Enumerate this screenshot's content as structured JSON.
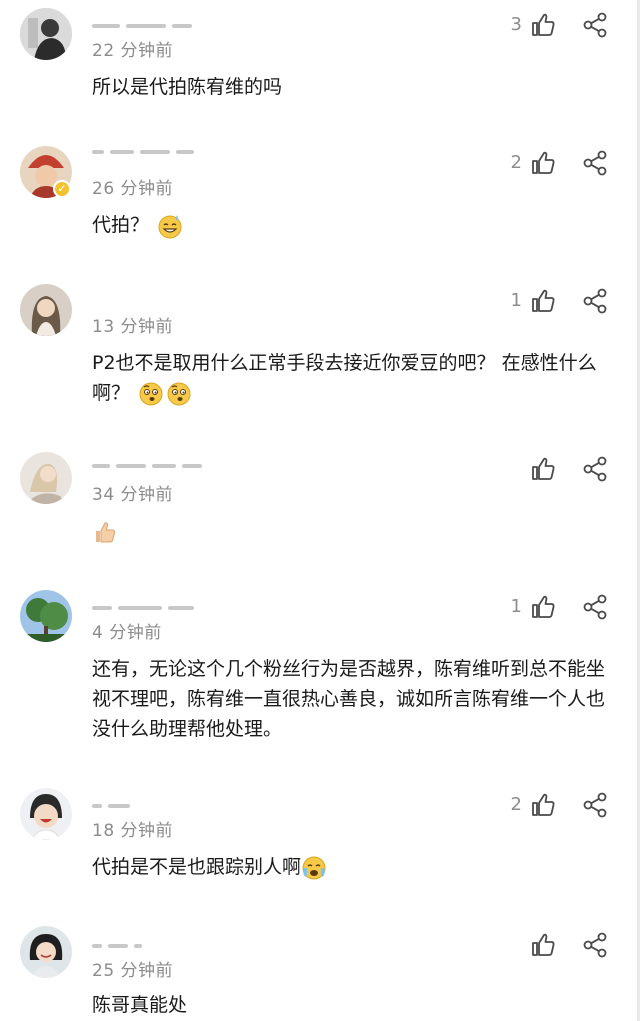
{
  "comments": [
    {
      "time": "22 分钟前",
      "text": "所以是代拍陈宥维的吗",
      "likes": "3",
      "avatar_icon": "avatar-man-portrait",
      "emojis": []
    },
    {
      "time": "26 分钟前",
      "text": "代拍？",
      "likes": "2",
      "avatar_icon": "avatar-costume-portrait",
      "verified": true,
      "emojis": [
        "sweat-smile-emoji"
      ]
    },
    {
      "time": "13 分钟前",
      "text": "P2也不是取用什么正常手段去接近你爱豆的吧？ 在感性什么啊？",
      "likes": "1",
      "avatar_icon": "avatar-woman-portrait",
      "emojis": [
        "thinking-emoji",
        "thinking-emoji"
      ]
    },
    {
      "time": "34 分钟前",
      "text": "",
      "likes": "",
      "avatar_icon": "avatar-woman-sitting",
      "emojis": [
        "thumbs-up-emoji"
      ]
    },
    {
      "time": "4 分钟前",
      "text": "还有，无论这个几个粉丝行为是否越界，陈宥维听到总不能坐视不理吧，陈宥维一直很热心善良，诚如所言陈宥维一个人也没什么助理帮他处理。",
      "likes": "1",
      "avatar_icon": "avatar-tree-sky",
      "emojis": []
    },
    {
      "time": "18 分钟前",
      "text": "代拍是不是也跟踪别人啊",
      "likes": "2",
      "avatar_icon": "avatar-laughing-person",
      "emojis": [
        "crying-emoji"
      ]
    },
    {
      "time": "25 分钟前",
      "text": "陈哥真能处",
      "likes": "",
      "avatar_icon": "avatar-woman-smiling",
      "emojis": []
    }
  ],
  "colors": {
    "meta": "#8c8c8c",
    "text": "#1a1a1a",
    "icon": "#4a4a4a",
    "verified": "#f2c230"
  }
}
